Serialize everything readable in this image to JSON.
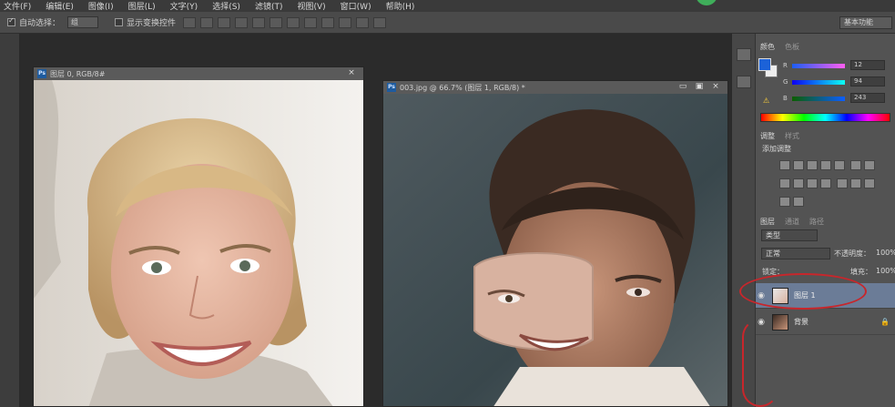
{
  "menu": {
    "items": [
      "文件(F)",
      "编辑(E)",
      "图像(I)",
      "图层(L)",
      "文字(Y)",
      "选择(S)",
      "滤镜(T)",
      "视图(V)",
      "窗口(W)",
      "帮助(H)"
    ]
  },
  "options_bar": {
    "auto_select_label": "自动选择：",
    "auto_select_value": "组",
    "show_transform_label": "显示变换控件",
    "workspace_label": "基本功能"
  },
  "doc1": {
    "title": "图层 0, RGB/8#",
    "close_glyph": "×"
  },
  "doc2": {
    "title": "003.jpg @ 66.7% (图层 1, RGB/8) *",
    "min_glyph": "▭",
    "max_glyph": "▣",
    "close_glyph": "×"
  },
  "panels": {
    "color_tab": "颜色",
    "swatches_tab": "色板",
    "r_value": "12",
    "g_value": "94",
    "b_value": "243",
    "adjust_tab": "调整",
    "styles_tab": "样式",
    "adjust_heading": "添加调整",
    "layers_tab": "图层",
    "channels_tab": "通道",
    "paths_tab": "路径",
    "kind_filter": "类型",
    "blend_mode": "正常",
    "opacity_label": "不透明度：",
    "opacity_value": "100%",
    "lock_label": "锁定：",
    "fill_label": "填充：",
    "fill_value": "100%"
  },
  "layers": [
    {
      "name": "图层 1",
      "selected": true
    },
    {
      "name": "背景",
      "selected": false
    }
  ],
  "colors": {
    "foreground": "#1c62d8",
    "accent_annotation": "#c8262b",
    "selected_layer": "#6b7c97"
  },
  "icons": {
    "eye": "eye-icon",
    "lock": "lock-icon",
    "ps": "ps-app-icon"
  }
}
